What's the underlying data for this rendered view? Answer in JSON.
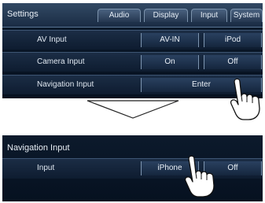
{
  "top_screen": {
    "title": "Settings",
    "tabs": [
      "Audio",
      "Display",
      "Input",
      "System"
    ],
    "rows": [
      {
        "label": "AV Input",
        "options": [
          "AV-IN",
          "iPod"
        ]
      },
      {
        "label": "Camera Input",
        "options": [
          "On",
          "Off"
        ]
      },
      {
        "label": "Navigation Input",
        "options": [
          "Enter"
        ]
      }
    ]
  },
  "bottom_screen": {
    "title": "Navigation Input",
    "rows": [
      {
        "label": "Input",
        "options": [
          "iPhone",
          "Off"
        ]
      }
    ]
  },
  "icons": {
    "transition": "down-arrow-icon",
    "pointer": "pointing-hand-icon"
  },
  "colors": {
    "screen_bg": "#0c1a2c",
    "tab_bg": "#324964",
    "text": "#e4ecf5"
  }
}
